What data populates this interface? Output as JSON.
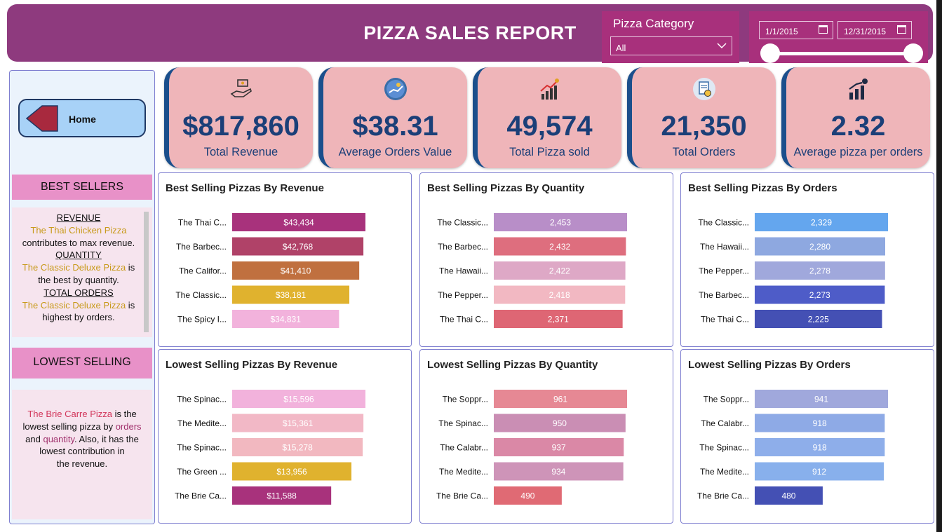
{
  "header": {
    "title": "PIZZA SALES REPORT",
    "category_label": "Pizza Category",
    "category_value": "All",
    "date_start": "1/1/2015",
    "date_end": "12/31/2015"
  },
  "sidebar": {
    "home_label": "Home",
    "best_header": "BEST SELLERS",
    "best_revenue_title": "REVENUE",
    "best_revenue_name": "The Thai Chicken Pizza",
    "best_revenue_text": "contributes to max revenue.",
    "best_quantity_title": "QUANTITY",
    "best_quantity_name": "The Classic Deluxe Pizza",
    "best_quantity_is": " is",
    "best_quantity_text": "the best by quantity.",
    "best_orders_title": "TOTAL ORDERS",
    "best_orders_name": "The Classic Deluxe Pizza",
    "best_orders_is": " is",
    "best_orders_text": "highest by orders.",
    "low_header": "LOWEST SELLING",
    "low_name": "The Brie Carre Pizza",
    "low_text1": " is the",
    "low_text2": "lowest selling pizza by ",
    "low_orders": "orders",
    "low_and": "and ",
    "low_quantity": "quantity",
    "low_text3": ". Also, it has the",
    "low_text4": "lowest contribution in",
    "low_text5": "the revenue."
  },
  "kpis": [
    {
      "value": "$817,860",
      "label": "Total Revenue",
      "icon": "money-hand-icon"
    },
    {
      "value": "$38.31",
      "label": "Average Orders Value",
      "icon": "money-circle-icon"
    },
    {
      "value": "49,574",
      "label": "Total Pizza sold",
      "icon": "growth-chart-icon"
    },
    {
      "value": "21,350",
      "label": "Total Orders",
      "icon": "order-document-icon"
    },
    {
      "value": "2.32",
      "label": "Average pizza per orders",
      "icon": "bar-growth-icon"
    }
  ],
  "colors": {
    "header": "#8e3a7e",
    "kpi_bg": "#efb5b9",
    "kpi_text": "#1b3f78"
  },
  "chart_data": [
    {
      "id": "best-revenue",
      "type": "bar",
      "title": "Best Selling Pizzas By Revenue",
      "categories": [
        "The Thai C...",
        "The Barbec...",
        "The Califor...",
        "The Classic...",
        "The Spicy I..."
      ],
      "values": [
        43434,
        42768,
        41410,
        38181,
        34831
      ],
      "labels": [
        "$43,434",
        "$42,768",
        "$41,410",
        "$38,181",
        "$34,831"
      ],
      "colors": [
        "#a8327c",
        "#b04268",
        "#c0703f",
        "#e0b22e",
        "#f2b2dc"
      ],
      "xmax": 43434
    },
    {
      "id": "best-quantity",
      "type": "bar",
      "title": "Best Selling Pizzas By Quantity",
      "categories": [
        "The Classic...",
        "The Barbec...",
        "The Hawaii...",
        "The Pepper...",
        "The Thai C..."
      ],
      "values": [
        2453,
        2432,
        2422,
        2418,
        2371
      ],
      "labels": [
        "2,453",
        "2,432",
        "2,422",
        "2,418",
        "2,371"
      ],
      "colors": [
        "#b88ec8",
        "#de6e7e",
        "#dea8c6",
        "#f2b8c2",
        "#de6674"
      ],
      "xmax": 2453
    },
    {
      "id": "best-orders",
      "type": "bar",
      "title": "Best Selling Pizzas By Orders",
      "categories": [
        "The Classic...",
        "The Hawaii...",
        "The Pepper...",
        "The Barbec...",
        "The Thai C..."
      ],
      "values": [
        2329,
        2280,
        2278,
        2273,
        2225
      ],
      "labels": [
        "2,329",
        "2,280",
        "2,278",
        "2,273",
        "2,225"
      ],
      "colors": [
        "#64a6ee",
        "#8ea8e0",
        "#a0a8dc",
        "#4e5cc8",
        "#4450b4"
      ],
      "xmax": 2329
    },
    {
      "id": "low-revenue",
      "type": "bar",
      "title": "Lowest Selling Pizzas By Revenue",
      "categories": [
        "The Spinac...",
        "The Medite...",
        "The Spinac...",
        "The Green ...",
        "The Brie Ca..."
      ],
      "values": [
        15596,
        15361,
        15278,
        13956,
        11588
      ],
      "labels": [
        "$15,596",
        "$15,361",
        "$15,278",
        "$13,956",
        "$11,588"
      ],
      "colors": [
        "#f2b2dc",
        "#f2b8c6",
        "#f2b8c0",
        "#e0b22e",
        "#a8327c"
      ],
      "xmax": 15596
    },
    {
      "id": "low-quantity",
      "type": "bar",
      "title": "Lowest Selling Pizzas By Quantity",
      "categories": [
        "The Soppr...",
        "The Spinac...",
        "The Calabr...",
        "The Medite...",
        "The Brie Ca..."
      ],
      "values": [
        961,
        950,
        937,
        934,
        490
      ],
      "labels": [
        "961",
        "950",
        "937",
        "934",
        "490"
      ],
      "colors": [
        "#e68894",
        "#ca8eb4",
        "#da88a6",
        "#ce94b8",
        "#e06a74"
      ],
      "xmax": 961
    },
    {
      "id": "low-orders",
      "type": "bar",
      "title": "Lowest Selling Pizzas By Orders",
      "categories": [
        "The Soppr...",
        "The Calabr...",
        "The Spinac...",
        "The Medite...",
        "The Brie Ca..."
      ],
      "values": [
        941,
        918,
        918,
        912,
        480
      ],
      "labels": [
        "941",
        "918",
        "918",
        "912",
        "480"
      ],
      "colors": [
        "#a0a8dc",
        "#8eaae6",
        "#8eaeea",
        "#88b0ec",
        "#4450b4"
      ],
      "xmax": 941
    }
  ]
}
